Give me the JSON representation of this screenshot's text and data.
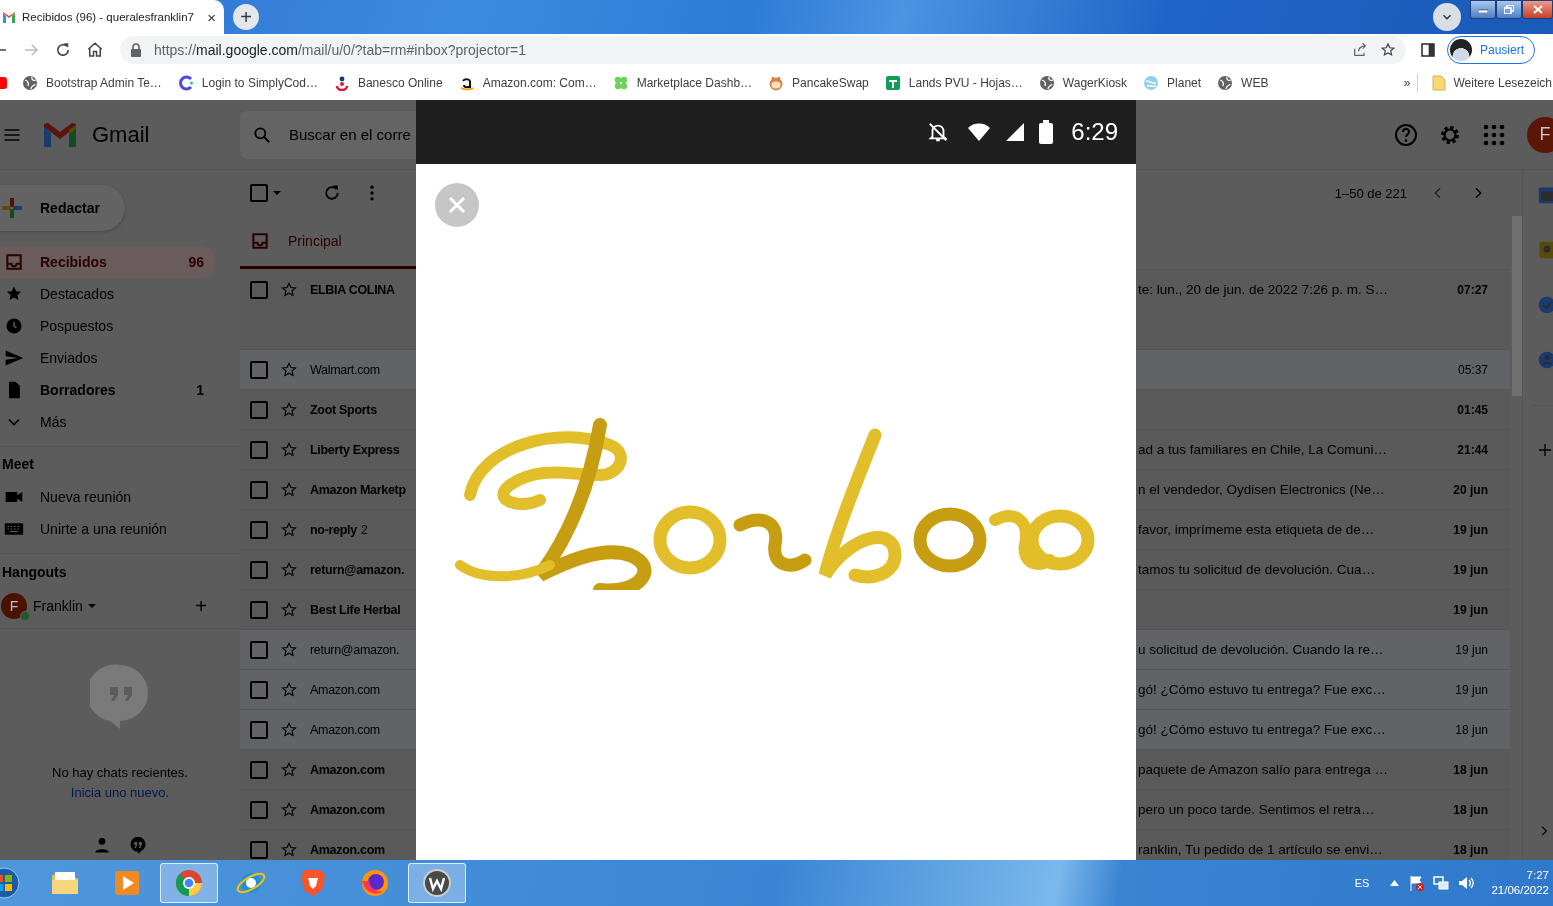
{
  "browser": {
    "tab": {
      "title": "Recibidos (96) - queralesfranklin7",
      "close": "×",
      "selected": true
    },
    "new_tab": "+",
    "url": {
      "scheme": "https://",
      "host": "mail.google.com",
      "path": "/mail/u/0/?tab=rm#inbox?projector=1"
    },
    "profile": "Pausiert",
    "bookmarks": [
      {
        "label": "Bootstrap Admin Te…"
      },
      {
        "label": "Login to SimplyCod…"
      },
      {
        "label": "Banesco Online"
      },
      {
        "label": "Amazon.com: Com…"
      },
      {
        "label": "Marketplace Dashb…"
      },
      {
        "label": "PancakeSwap"
      },
      {
        "label": "Lands PVU - Hojas…"
      },
      {
        "label": "WagerKiosk"
      },
      {
        "label": "Planet"
      },
      {
        "label": "WEB"
      }
    ],
    "bookmarks_more": "»",
    "bookmarks_folder": "Weitere Lesezeich"
  },
  "gmail": {
    "brand": "Gmail",
    "search": {
      "placeholder": "Buscar en el corre"
    },
    "avatar": "F",
    "compose": "Redactar",
    "nav": [
      {
        "label": "Recibidos",
        "count": "96",
        "selected": true,
        "unread": true
      },
      {
        "label": "Destacados",
        "selected": false,
        "unread": false
      },
      {
        "label": "Pospuestos",
        "selected": false,
        "unread": false
      },
      {
        "label": "Enviados",
        "selected": false,
        "unread": false
      },
      {
        "label": "Borradores",
        "count": "1",
        "selected": false,
        "unread": true
      },
      {
        "label": "Más",
        "selected": false,
        "unread": false
      }
    ],
    "meet": {
      "heading": "Meet",
      "items": [
        "Nueva reunión",
        "Unirte a una reunión"
      ]
    },
    "hangouts": {
      "heading": "Hangouts",
      "user": {
        "initial": "F",
        "name": "Franklin",
        "online": true
      },
      "add": "+",
      "empty": "No hay chats recientes.",
      "start_link": "Inicia uno nuevo."
    },
    "select_all": {
      "checked": false
    },
    "pagination": "1–50 de 221",
    "tabs": [
      {
        "label": "Principal",
        "selected": true
      }
    ],
    "emails": [
      {
        "sender": "ELBIA COLINA",
        "snippet": "te: lun., 20 de jun. de 2022 7:26 p. m. S…",
        "date": "07:27",
        "unread": true
      },
      {
        "sender": "Walmart.com",
        "date": "05:37",
        "unread": false
      },
      {
        "sender": "Zoot Sports",
        "date": "01:45",
        "unread": true
      },
      {
        "sender": "Liberty Express",
        "snippet": "ad a tus familiares en Chile, La Comuni…",
        "date": "21:44",
        "unread": true
      },
      {
        "sender": "Amazon Marketp",
        "snippet": "n el vendedor, Oydisen Electronics (Ne…",
        "date": "20 jun",
        "unread": true
      },
      {
        "sender": "no-reply",
        "count": "2",
        "snippet": "favor, imprímeme esta etiqueta de de…",
        "date": "19 jun",
        "unread": true
      },
      {
        "sender": "return@amazon.",
        "snippet": "tamos tu solicitud de devolución. Cua…",
        "date": "19 jun",
        "unread": true
      },
      {
        "sender": "Best Life Herbal",
        "date": "19 jun",
        "unread": true
      },
      {
        "sender": "return@amazon.",
        "snippet": "u solicitud de devolución. Cuando la re…",
        "date": "19 jun",
        "unread": false
      },
      {
        "sender": "Amazon.com",
        "snippet": "gó! ¿Cómo estuvo tu entrega? Fue exc…",
        "date": "19 jun",
        "unread": false
      },
      {
        "sender": "Amazon.com",
        "snippet": "gó! ¿Cómo estuvo tu entrega? Fue exc…",
        "date": "18 jun",
        "unread": false
      },
      {
        "sender": "Amazon.com",
        "snippet": "paquete de Amazon salío para entrega …",
        "date": "18 jun",
        "unread": true
      },
      {
        "sender": "Amazon.com",
        "snippet": "pero un poco tarde. Sentimos el retra…",
        "date": "18 jun",
        "unread": true
      },
      {
        "sender": "Amazon.com",
        "snippet": "ranklin, Tu pedido de 1 artículo se envi…",
        "date": "18 jun",
        "unread": true
      }
    ]
  },
  "viewer": {
    "status_time": "6:29"
  },
  "taskbar": {
    "apps": [
      {
        "active": false
      },
      {
        "active": false
      },
      {
        "active": true
      },
      {
        "active": false
      },
      {
        "active": false
      },
      {
        "active": false
      },
      {
        "active": true
      }
    ],
    "language": "ES",
    "time": "7:27",
    "date": "21/06/2022"
  }
}
